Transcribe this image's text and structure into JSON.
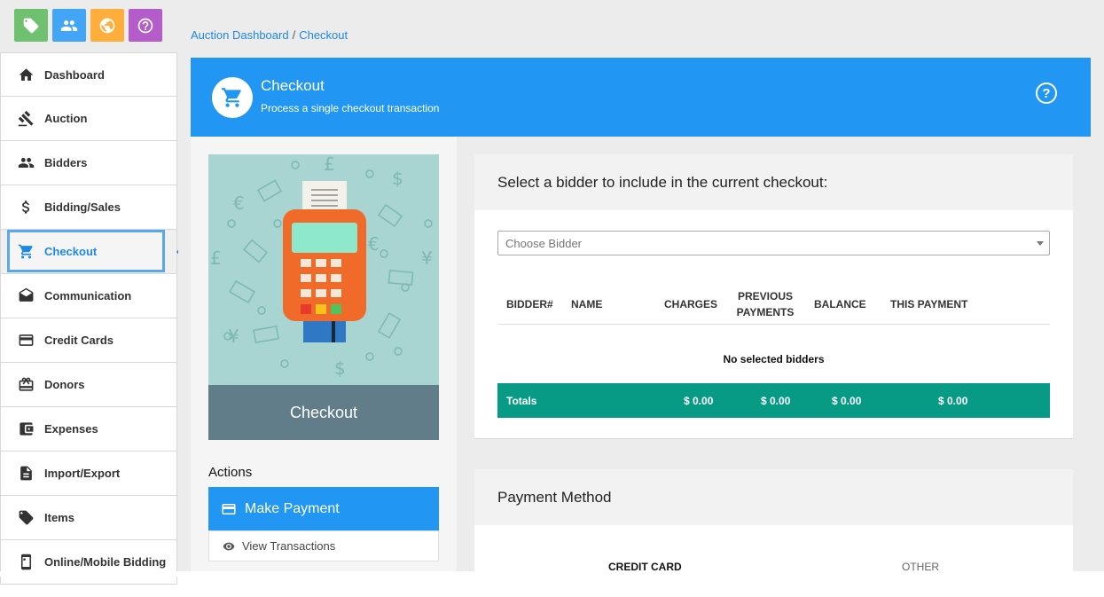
{
  "quick_actions": [
    {
      "icon": "tag-icon",
      "color": "#6fc06f"
    },
    {
      "icon": "people-icon",
      "color": "#42a5f5"
    },
    {
      "icon": "globe-icon",
      "color": "#ffae3c"
    },
    {
      "icon": "help-icon",
      "color": "#b45cc9"
    }
  ],
  "sidebar": {
    "items": [
      {
        "label": "Dashboard",
        "icon": "home-icon"
      },
      {
        "label": "Auction",
        "icon": "gavel-icon"
      },
      {
        "label": "Bidders",
        "icon": "people-icon"
      },
      {
        "label": "Bidding/Sales",
        "icon": "dollar-icon"
      },
      {
        "label": "Checkout",
        "icon": "cart-icon",
        "active": true
      },
      {
        "label": "Communication",
        "icon": "envelope-icon"
      },
      {
        "label": "Credit Cards",
        "icon": "credit-card-icon"
      },
      {
        "label": "Donors",
        "icon": "gift-icon"
      },
      {
        "label": "Expenses",
        "icon": "wallet-icon"
      },
      {
        "label": "Import/Export",
        "icon": "document-icon"
      },
      {
        "label": "Items",
        "icon": "tag-icon"
      },
      {
        "label": "Online/Mobile Bidding",
        "icon": "mobile-icon"
      }
    ]
  },
  "breadcrumb": {
    "home": "Auction Dashboard",
    "sep": "/",
    "current": "Checkout"
  },
  "header": {
    "title": "Checkout",
    "subtitle": "Process a single checkout transaction",
    "help": "?"
  },
  "illustration": {
    "caption": "Checkout"
  },
  "actions": {
    "title": "Actions",
    "make_payment": "Make Payment",
    "view_transactions": "View Transactions"
  },
  "bidder_card": {
    "title": "Select a bidder to include in the current checkout:",
    "select_placeholder": "Choose Bidder",
    "columns": [
      "BIDDER#",
      "NAME",
      "CHARGES",
      "PREVIOUS PAYMENTS",
      "BALANCE",
      "THIS PAYMENT"
    ],
    "empty_message": "No selected bidders",
    "totals": {
      "label": "Totals",
      "charges": "$ 0.00",
      "previous_payments": "$ 0.00",
      "balance": "$ 0.00",
      "this_payment": "$ 0.00"
    }
  },
  "payment_method": {
    "title": "Payment Method",
    "tabs": [
      "CREDIT CARD",
      "OTHER"
    ]
  },
  "colors": {
    "primary": "#2196f3",
    "totals_bar": "#079b86",
    "illustration_bg": "#a8d5d1",
    "caption_bg": "#627d8a"
  }
}
